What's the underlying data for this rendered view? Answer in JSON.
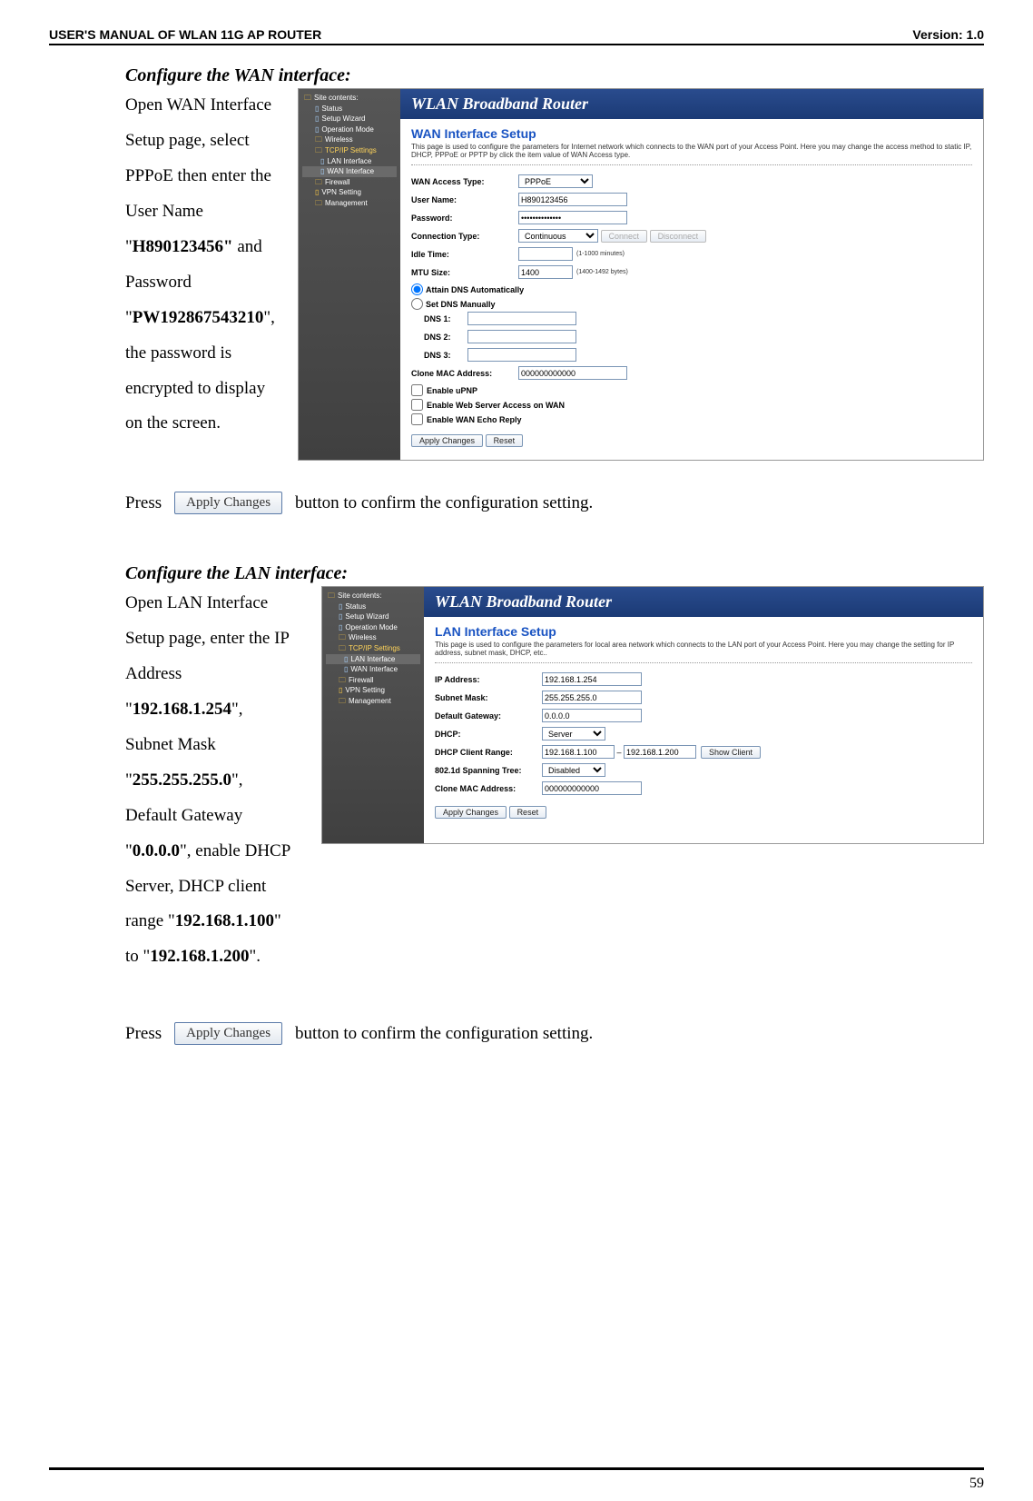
{
  "doc_header": {
    "left": "USER'S MANUAL OF WLAN 11G AP ROUTER",
    "right": "Version: 1.0"
  },
  "sectionA": {
    "title": "Configure the WAN interface:",
    "body_lines": [
      "Open WAN Interface",
      "Setup page, select",
      "PPPoE then enter the",
      "User Name",
      "\"",
      "H890123456\"",
      " and",
      "Password",
      "\"",
      "PW192867543210",
      "\",",
      "the password is",
      "encrypted to display",
      "on the screen."
    ]
  },
  "sectionB": {
    "title": "Configure the LAN interface:",
    "body_parts": {
      "l1": "Open LAN Interface",
      "l2": "Setup page, enter the IP",
      "l3": "Address",
      "ip": "192.168.1.254",
      "mask_label": "Subnet Mask",
      "mask": "255.255.255.0",
      "gw_label": "Default Gateway",
      "gw": "0.0.0.0",
      "l4a": "\", enable DHCP",
      "l5": "Server, DHCP client",
      "l6a": "range \"",
      "range_start": "192.168.1.100",
      "l7a": "to \"",
      "range_end": "192.168.1.200"
    }
  },
  "apply_button": "Apply Changes",
  "press": "Press",
  "press_tail": "button to confirm the configuration setting.",
  "page_number": "59",
  "router_title": "WLAN Broadband Router",
  "sidebar": {
    "site": "Site contents:",
    "items": [
      "Status",
      "Setup Wizard",
      "Operation Mode",
      "Wireless"
    ],
    "tcpip": "TCP/IP Settings",
    "lan": "LAN Interface",
    "wan": "WAN Interface",
    "items2": [
      "Firewall",
      "VPN Setting",
      "Management"
    ]
  },
  "wan_screen": {
    "title": "WAN Interface Setup",
    "desc": "This page is used to configure the parameters for Internet network which connects to the WAN port of your Access Point. Here you may change the access method to static IP, DHCP, PPPoE or PPTP by click the item value of WAN Access type.",
    "labels": {
      "access": "WAN Access Type:",
      "user": "User Name:",
      "pass": "Password:",
      "conn": "Connection Type:",
      "idle": "Idle Time:",
      "mtu": "MTU Size:",
      "dns_auto": "Attain DNS Automatically",
      "dns_man": "Set DNS Manually",
      "dns1": "DNS 1:",
      "dns2": "DNS 2:",
      "dns3": "DNS 3:",
      "clone": "Clone MAC Address:",
      "upnp": "Enable uPNP",
      "webwan": "Enable Web Server Access on WAN",
      "echo": "Enable WAN Echo Reply",
      "apply": "Apply Changes",
      "reset": "Reset",
      "connect": "Connect",
      "disconnect": "Disconnect"
    },
    "values": {
      "access": "PPPoE",
      "user": "H890123456",
      "pass": "••••••••••••••",
      "conn": "Continuous",
      "idle": "",
      "idle_hint": "(1-1000 minutes)",
      "mtu": "1400",
      "mtu_hint": "(1400-1492 bytes)",
      "clone": "000000000000"
    }
  },
  "lan_screen": {
    "title": "LAN Interface Setup",
    "desc": "This page is used to configure the parameters for local area network which connects to the LAN port of your Access Point. Here you may change the setting for IP address, subnet mask, DHCP, etc..",
    "labels": {
      "ip": "IP Address:",
      "mask": "Subnet Mask:",
      "gw": "Default Gateway:",
      "dhcp": "DHCP:",
      "range": "DHCP Client Range:",
      "stp": "802.1d Spanning Tree:",
      "clone": "Clone MAC Address:",
      "show": "Show Client",
      "apply": "Apply Changes",
      "reset": "Reset"
    },
    "values": {
      "ip": "192.168.1.254",
      "mask": "255.255.255.0",
      "gw": "0.0.0.0",
      "dhcp": "Server",
      "range_a": "192.168.1.100",
      "range_b": "192.168.1.200",
      "stp": "Disabled",
      "clone": "000000000000"
    }
  }
}
